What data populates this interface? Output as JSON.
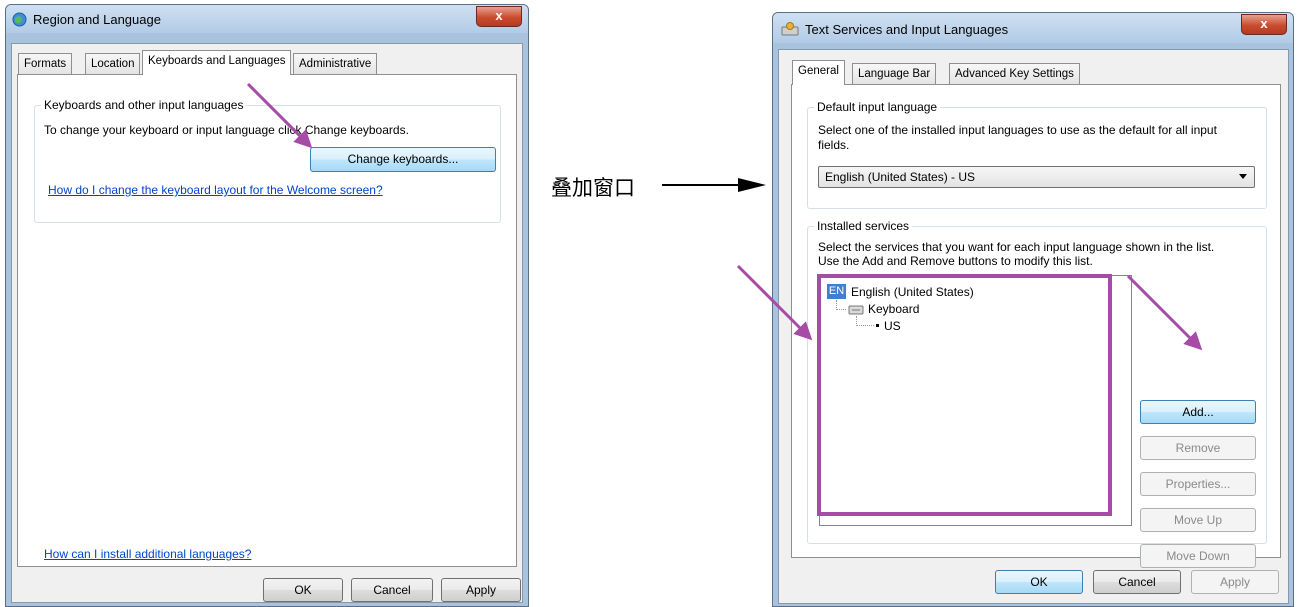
{
  "left_dialog": {
    "title": "Region and Language",
    "close": "x",
    "tabs": [
      {
        "label": "Formats"
      },
      {
        "label": "Location"
      },
      {
        "label": "Keyboards and Languages"
      },
      {
        "label": "Administrative"
      }
    ],
    "group_title": "Keyboards and other input languages",
    "instruction": "To change your keyboard or input language click Change keyboards.",
    "change_keyboards_button": "Change keyboards...",
    "welcome_link": "How do I change the keyboard layout for the Welcome screen?",
    "install_link": "How can I install additional languages?",
    "buttons": {
      "ok": "OK",
      "cancel": "Cancel",
      "apply": "Apply"
    }
  },
  "annotation": {
    "label": "叠加窗口",
    "highlight_color": "#a64ca6"
  },
  "right_dialog": {
    "title": "Text Services and Input Languages",
    "close": "x",
    "tabs": [
      {
        "label": "General"
      },
      {
        "label": "Language Bar"
      },
      {
        "label": "Advanced Key Settings"
      }
    ],
    "default_group_title": "Default input language",
    "default_desc_1": "Select one of the installed input languages to use as the default for all input",
    "default_desc_2": "fields.",
    "default_value": "English (United States) - US",
    "services_group_title": "Installed services",
    "services_desc_1": "Select the services that you want for each input language shown in the list.",
    "services_desc_2": "Use the Add and Remove buttons to modify this list.",
    "tree": {
      "lang_badge": "EN",
      "language": "English (United States)",
      "category": "Keyboard",
      "layout": "US"
    },
    "side_buttons": {
      "add": "Add...",
      "remove": "Remove",
      "properties": "Properties...",
      "move_up": "Move Up",
      "move_down": "Move Down"
    },
    "buttons": {
      "ok": "OK",
      "cancel": "Cancel",
      "apply": "Apply"
    }
  }
}
